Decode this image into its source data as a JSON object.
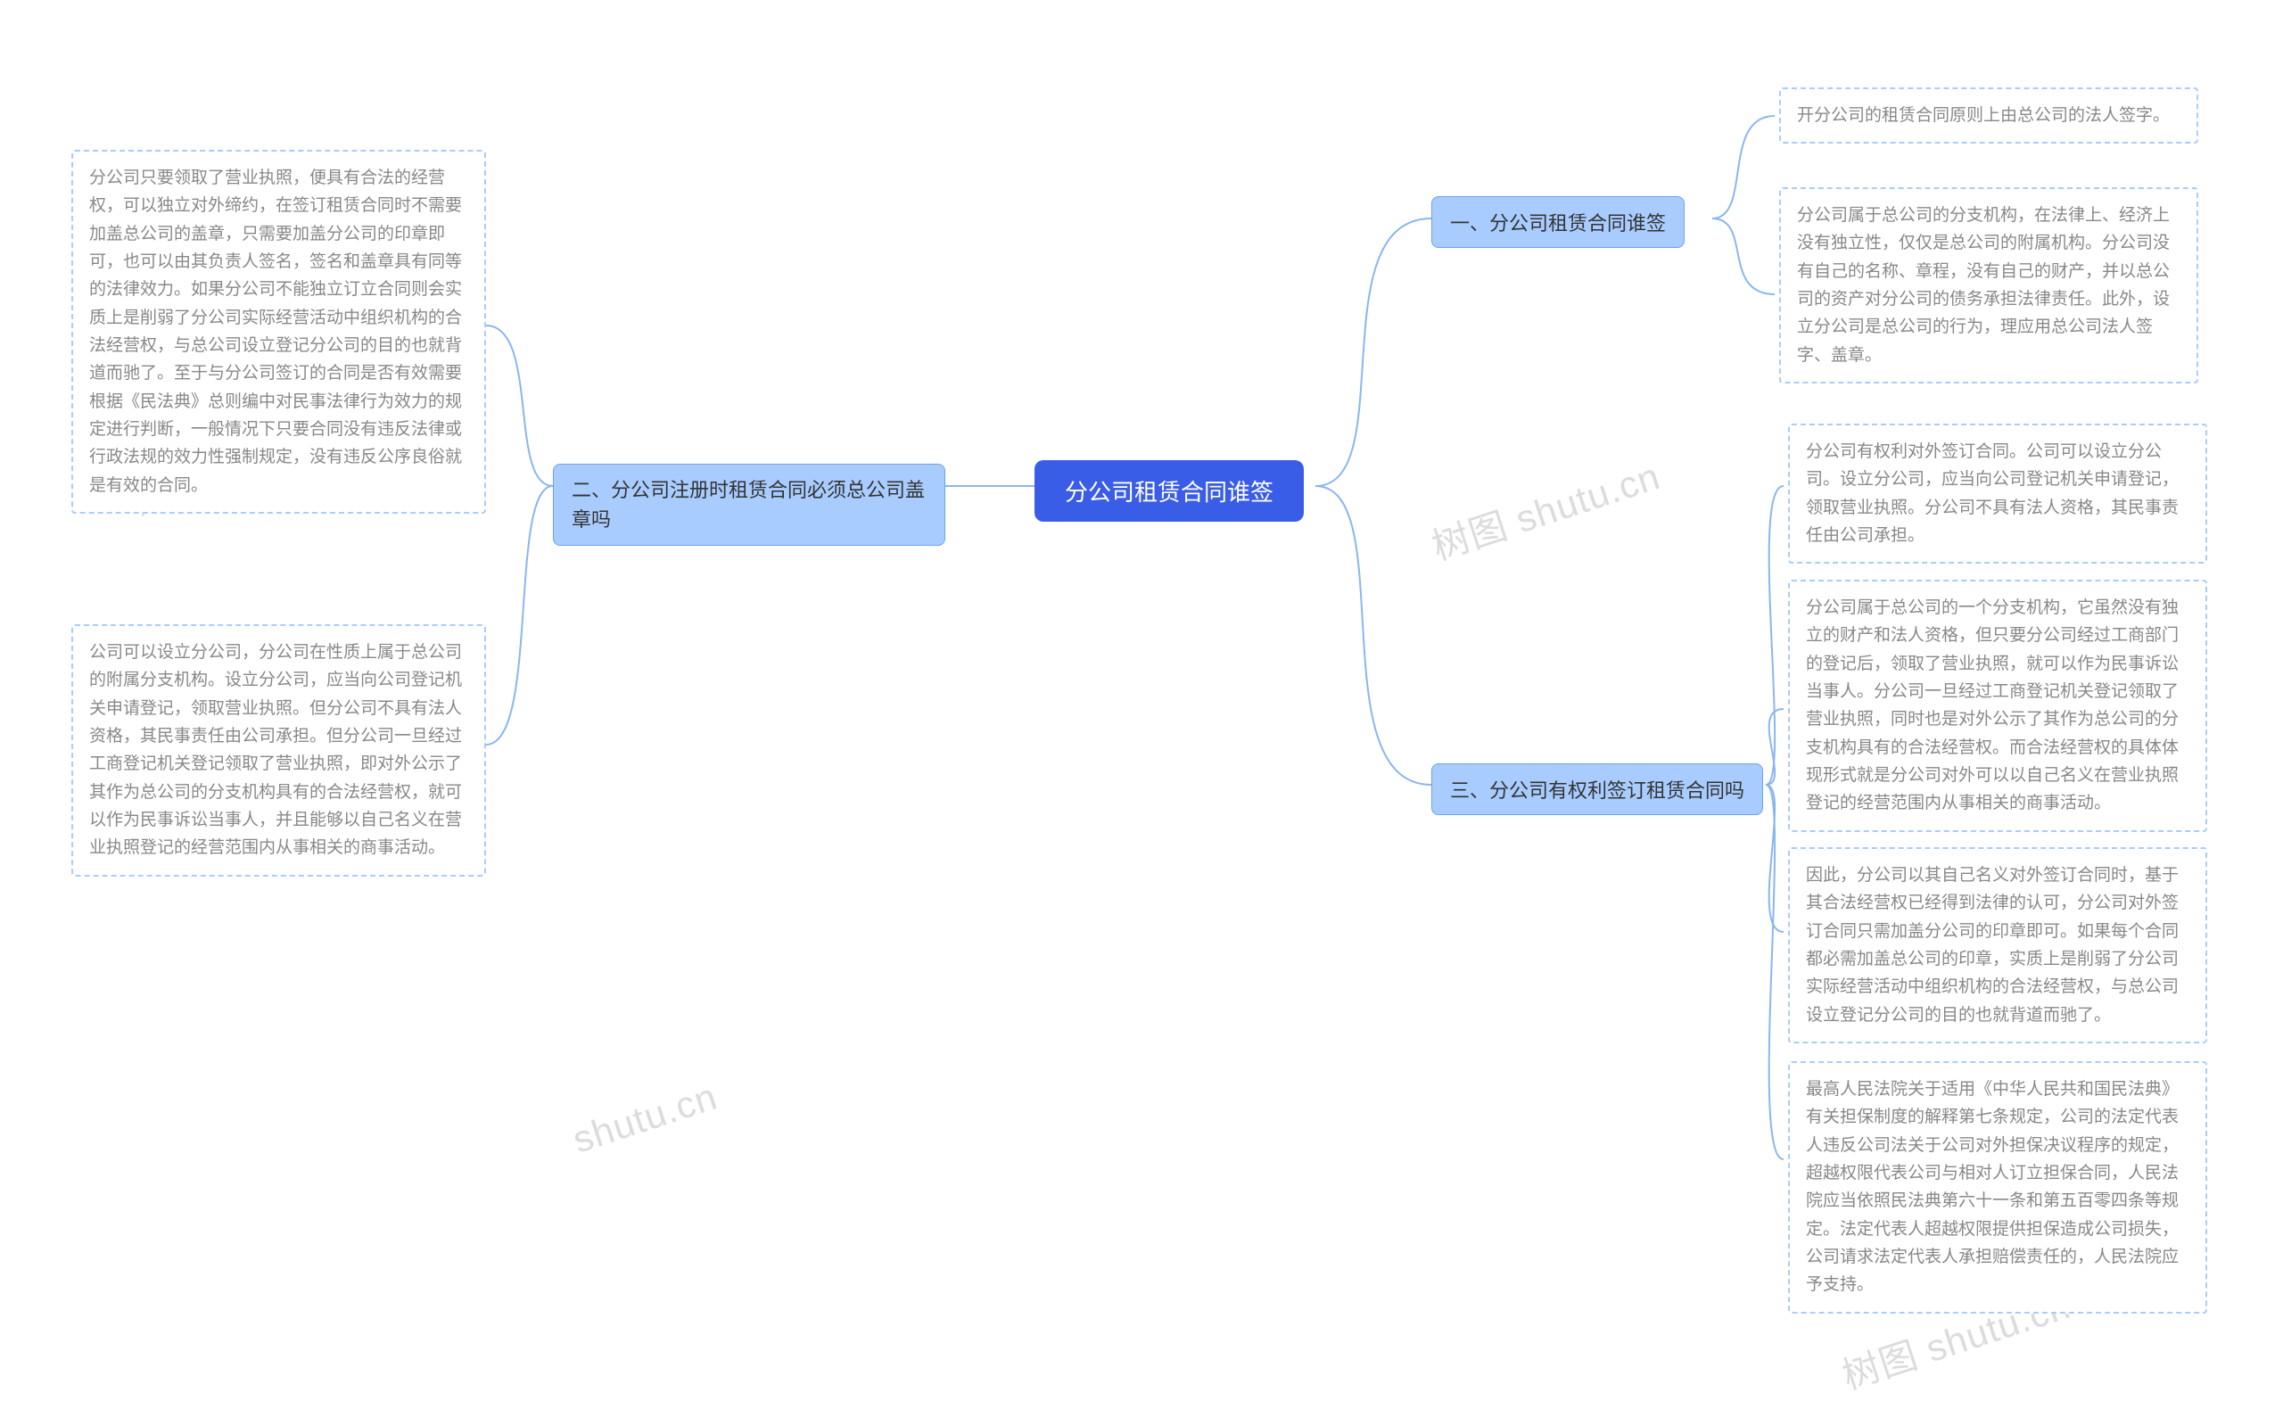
{
  "central": {
    "title": "分公司租赁合同谁签"
  },
  "branches": {
    "b1": {
      "title": "一、分公司租赁合同谁签"
    },
    "b2": {
      "title": "二、分公司注册时租赁合同必须总公司盖章吗"
    },
    "b3": {
      "title": "三、分公司有权利签订租赁合同吗"
    }
  },
  "leaves": {
    "l1a": "开分公司的租赁合同原则上由总公司的法人签字。",
    "l1b": "分公司属于总公司的分支机构，在法律上、经济上没有独立性，仅仅是总公司的附属机构。分公司没有自己的名称、章程，没有自己的财产，并以总公司的资产对分公司的债务承担法律责任。此外，设立分公司是总公司的行为，理应用总公司法人签字、盖章。",
    "l2a": "分公司只要领取了营业执照，便具有合法的经营权，可以独立对外缔约，在签订租赁合同时不需要加盖总公司的盖章，只需要加盖分公司的印章即可，也可以由其负责人签名，签名和盖章具有同等的法律效力。如果分公司不能独立订立合同则会实质上是削弱了分公司实际经营活动中组织机构的合法经营权，与总公司设立登记分公司的目的也就背道而驰了。至于与分公司签订的合同是否有效需要根据《民法典》总则编中对民事法律行为效力的规定进行判断，一般情况下只要合同没有违反法律或行政法规的效力性强制规定，没有违反公序良俗就是有效的合同。",
    "l2b": "公司可以设立分公司，分公司在性质上属于总公司的附属分支机构。设立分公司，应当向公司登记机关申请登记，领取营业执照。但分公司不具有法人资格，其民事责任由公司承担。但分公司一旦经过工商登记机关登记领取了营业执照，即对外公示了其作为总公司的分支机构具有的合法经营权，就可以作为民事诉讼当事人，并且能够以自己名义在营业执照登记的经营范围内从事相关的商事活动。",
    "l3a": "分公司有权利对外签订合同。公司可以设立分公司。设立分公司，应当向公司登记机关申请登记，领取营业执照。分公司不具有法人资格，其民事责任由公司承担。",
    "l3b": "分公司属于总公司的一个分支机构，它虽然没有独立的财产和法人资格，但只要分公司经过工商部门的登记后，领取了营业执照，就可以作为民事诉讼当事人。分公司一旦经过工商登记机关登记领取了营业执照，同时也是对外公示了其作为总公司的分支机构具有的合法经营权。而合法经营权的具体体现形式就是分公司对外可以以自己名义在营业执照登记的经营范围内从事相关的商事活动。",
    "l3c": "因此，分公司以其自己名义对外签订合同时，基于其合法经营权已经得到法律的认可，分公司对外签订合同只需加盖分公司的印章即可。如果每个合同都必需加盖总公司的印章，实质上是削弱了分公司实际经营活动中组织机构的合法经营权，与总公司设立登记分公司的目的也就背道而驰了。",
    "l3d": "最高人民法院关于适用《中华人民共和国民法典》有关担保制度的解释第七条规定，公司的法定代表人违反公司法关于公司对外担保决议程序的规定，超越权限代表公司与相对人订立担保合同，人民法院应当依照民法典第六十一条和第五百零四条等规定。法定代表人超越权限提供担保造成公司损失，公司请求法定代表人承担赔偿责任的，人民法院应予支持。"
  },
  "watermarks": {
    "w1": "树图 shutu.cn",
    "w2": "shutu.cn",
    "w3": "树图 shutu.cn",
    "w4": "树图 shutu.cn"
  }
}
